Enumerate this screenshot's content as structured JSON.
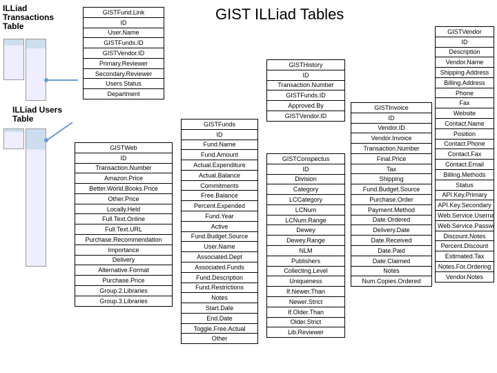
{
  "title": "GIST ILLiad Tables",
  "heading1": "ILLiad Transactions Table",
  "heading2": "ILLiad Users Table",
  "tables": {
    "GISTFundLink": [
      "GISTFund.Link",
      "ID",
      "User.Name",
      "GISTFunds.ID",
      "GISTVendor.ID",
      "Primary.Reviewer",
      "Secondary.Reviewer",
      "Users.Status",
      "Department"
    ],
    "GISTWeb": [
      "GISTWeb",
      "ID",
      "Transaction.Number",
      "Amazon.Price",
      "Better.World.Books.Price",
      "Other.Price",
      "Locally.Held",
      "Full.Text.Online",
      "Full.Text.URL",
      "Purchase.Recommendation",
      "Importance",
      "Delivery",
      "Alternative.Format",
      "Purchase.Price",
      "Group.2.Libraries",
      "Group.3.Libraries"
    ],
    "GISTFunds": [
      "GISTFunds",
      "ID",
      "Fund.Name",
      "Fund.Amount",
      "Actual.Expenditure",
      "Actual.Balance",
      "Commitments",
      "Free.Balance",
      "Percent.Expended",
      "Fund.Year",
      "Active",
      "Fund.Budget.Source",
      "User.Name",
      "Associated.Dept",
      "Associated.Funds",
      "Fund.Description",
      "Fund.Restrictions",
      "Notes",
      "Start.Date",
      "End.Date",
      "Toggle.Free.Actual",
      "Other"
    ],
    "GISTHistory": [
      "GISTHistory",
      "ID",
      "Transaction.Number",
      "GISTFunds.ID",
      "Approved.By",
      "GISTVendor.ID"
    ],
    "GISTConspectus": [
      "GISTConspectus",
      "ID",
      "Division",
      "Category",
      "LCCategory",
      "LCNum",
      "LCNum.Range",
      "Dewey",
      "Dewey.Range",
      "NLM",
      "Publishers",
      "Collecting.Level",
      "Uniqueness",
      "If.Newer.Than",
      "Newer.Strict",
      "If.Older.Than",
      "Older.Strict",
      "Lib.Reviewer"
    ],
    "GISTInvoice": [
      "GISTInvoice",
      "ID",
      "Vendor.ID",
      "Vendor.Invoice",
      "Transaction.Number",
      "Final.Price",
      "Tax",
      "Shipping",
      "Fund.Budget.Source",
      "Purchase.Order",
      "Payment.Method",
      "Date.Ordered",
      "Delivery.Date",
      "Date.Received",
      "Date.Paid",
      "Date.Claimed",
      "Notes",
      "Num.Copies.Ordered"
    ],
    "GISTVendor": [
      "GISTVendor",
      "ID",
      "Description",
      "Vendor.Name",
      "Shipping.Address",
      "Billing.Address",
      "Phone",
      "Fax",
      "Website",
      "Contact.Name",
      "Position",
      "Contact.Phone",
      "Contact.Fax",
      "Contact.Email",
      "Billing.Methods",
      "Status",
      "API.Key.Primary",
      "API.Key.Secondary",
      "Web.Service.Username",
      "Web.Service.Password",
      "Discount.Notes",
      "Percent.Discount",
      "Estimated.Tax",
      "Notes.For.Ordering",
      "Vendor.Notes"
    ]
  }
}
